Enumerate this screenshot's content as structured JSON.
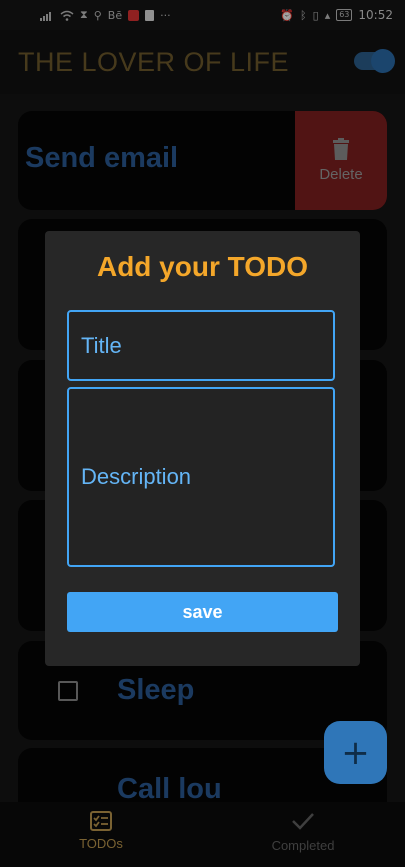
{
  "status_bar": {
    "time": "10:52",
    "battery": "63",
    "carrier_hint": "Bē",
    "more": "···"
  },
  "app_bar": {
    "title": "THE LOVER OF LIFE",
    "toggle_on": true
  },
  "list": {
    "items": [
      {
        "title": "Send email",
        "delete_label": "Delete"
      },
      {
        "title": ""
      },
      {
        "title": ""
      },
      {
        "title": ""
      },
      {
        "title": "Sleep"
      },
      {
        "title": "Call lou"
      }
    ]
  },
  "dialog": {
    "title": "Add your TODO",
    "title_placeholder": "Title",
    "description_placeholder": "Description",
    "save_label": "save"
  },
  "fab": {
    "label": "+"
  },
  "bottom_nav": {
    "items": [
      {
        "label": "TODOs",
        "icon": "todo-list-icon",
        "active": true
      },
      {
        "label": "Completed",
        "icon": "check-icon",
        "active": false
      }
    ]
  },
  "colors": {
    "accent_orange": "#f4a72a",
    "accent_blue": "#42a5f5",
    "delete_red": "#7d1f1f"
  }
}
